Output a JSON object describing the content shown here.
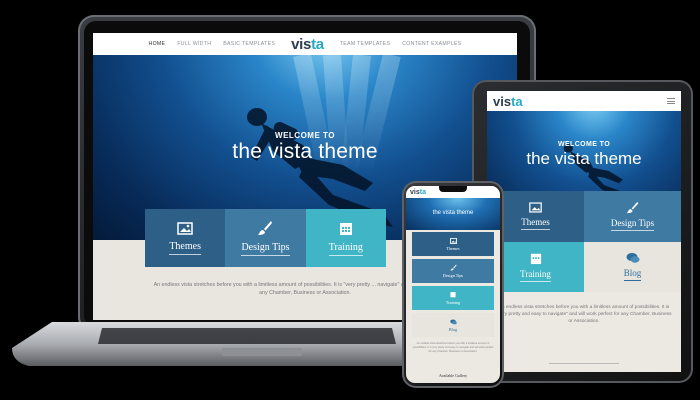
{
  "laptop": {
    "nav": {
      "items": [
        "HOME",
        "FULL WIDTH",
        "BASIC TEMPLATES",
        "TEAM TEMPLATES",
        "CONTENT EXAMPLES"
      ],
      "logo_a": "vis",
      "logo_b": "ta"
    },
    "hero": {
      "welcome": "WELCOME TO",
      "title": "the vista theme"
    },
    "tiles": [
      {
        "label": "Themes",
        "icon": "image-icon"
      },
      {
        "label": "Design Tips",
        "icon": "paintbrush-icon"
      },
      {
        "label": "Training",
        "icon": "calendar-icon"
      }
    ],
    "body_text": "An endless vista stretches before you with a limitless amount of possibilities. It is \"very pretty ... navigate\" and will work perfect for any Chamber, Business or Association."
  },
  "tablet": {
    "logo_a": "vis",
    "logo_b": "ta",
    "hero": {
      "welcome": "WELCOME TO",
      "title": "the vista theme"
    },
    "tiles": [
      {
        "label": "Themes",
        "icon": "image-icon"
      },
      {
        "label": "Design Tips",
        "icon": "paintbrush-icon"
      },
      {
        "label": "Training",
        "icon": "calendar-icon"
      },
      {
        "label": "Blog",
        "icon": "chat-icon"
      }
    ],
    "body_text": "An endless vista stretches before you with a limitless amount of possibilities. It is \"very pretty and easy to navigate\" and will work perfect for any Chamber, Business or Association."
  },
  "phone": {
    "logo_a": "vis",
    "logo_b": "ta",
    "hero_title": "the vista theme",
    "tiles": [
      {
        "label": "Themes",
        "icon": "image-icon"
      },
      {
        "label": "Design Tips",
        "icon": "paintbrush-icon"
      },
      {
        "label": "Training",
        "icon": "calendar-icon"
      },
      {
        "label": "Blog",
        "icon": "chat-icon"
      }
    ],
    "body_text": "An endless vista stretches before you with a limitless amount of possibilities. It is very pretty and easy to navigate and will work perfect for any Chamber, Business or Association.",
    "footer": "Available Gallery"
  },
  "colors": {
    "background": "#000000",
    "tile_dark": "#2e5f86",
    "tile_mid": "#3f7aa3",
    "tile_teal": "#3fb5c6",
    "accent": "#25a9c6"
  }
}
